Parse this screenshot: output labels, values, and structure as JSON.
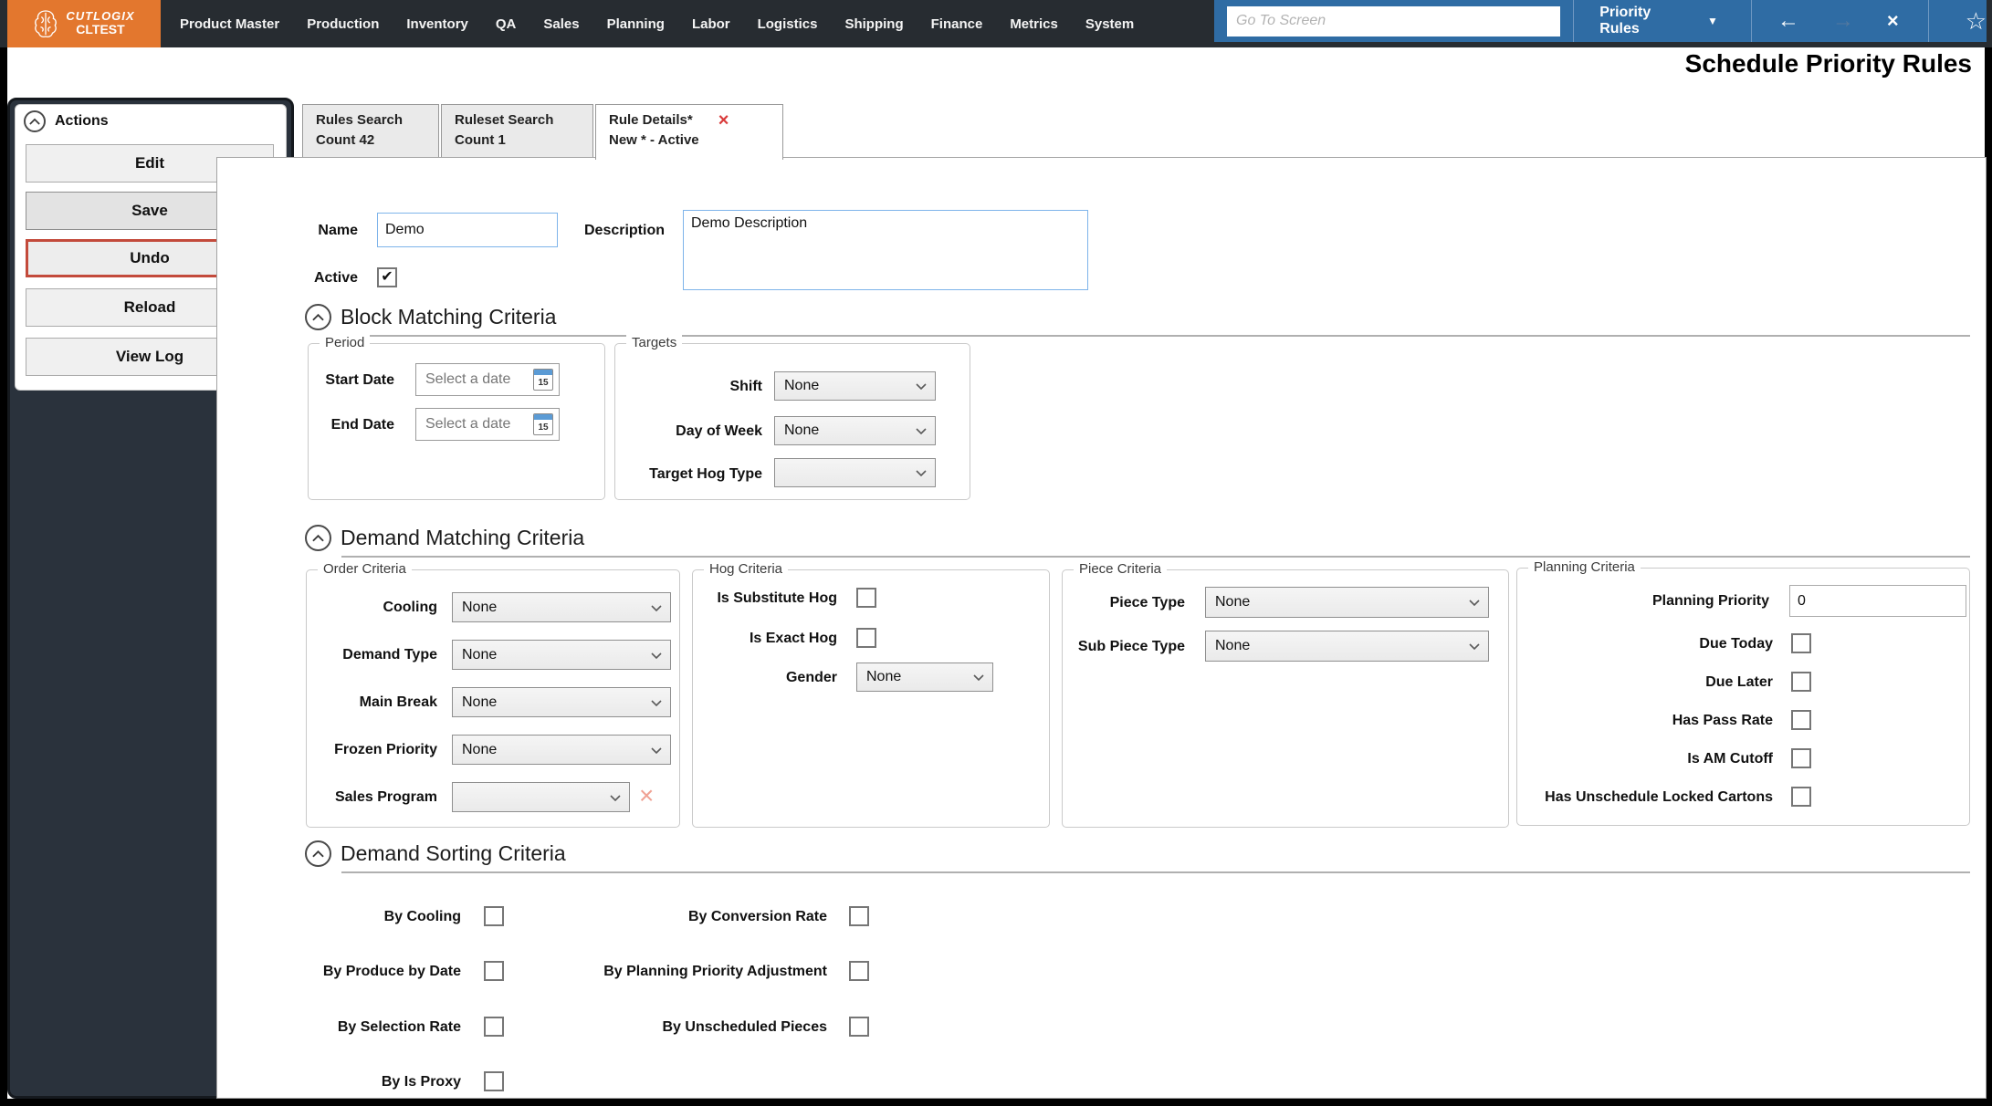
{
  "topbar": {
    "brand_line1": "CUTLOGIX",
    "brand_line2": "CLTEST",
    "menu": [
      "Product Master",
      "Production",
      "Inventory",
      "QA",
      "Sales",
      "Planning",
      "Labor",
      "Logistics",
      "Shipping",
      "Finance",
      "Metrics",
      "System"
    ],
    "goto_placeholder": "Go To Screen",
    "nav_selector": "Priority Rules"
  },
  "page_title": "Schedule Priority Rules",
  "tabs": {
    "rules_search": {
      "line1": "Rules Search",
      "line2": "Count 42"
    },
    "ruleset_search": {
      "line1": "Ruleset Search",
      "line2": "Count 1"
    },
    "rule_details": {
      "line1": "Rule Details*",
      "line2": "New * - Active"
    }
  },
  "actions": {
    "title": "Actions",
    "edit": "Edit",
    "save": "Save",
    "undo": "Undo",
    "reload": "Reload",
    "view_log": "View Log"
  },
  "form": {
    "name_label": "Name",
    "name_value": "Demo",
    "description_label": "Description",
    "description_value": "Demo Description",
    "active_label": "Active",
    "active_checked": true
  },
  "block_matching": {
    "title": "Block Matching Criteria",
    "period": {
      "legend": "Period",
      "start_label": "Start Date",
      "end_label": "End Date",
      "date_placeholder": "Select a date"
    },
    "targets": {
      "legend": "Targets",
      "shift_label": "Shift",
      "shift_value": "None",
      "dow_label": "Day of Week",
      "dow_value": "None",
      "hog_label": "Target Hog Type",
      "hog_value": ""
    }
  },
  "demand_matching": {
    "title": "Demand Matching Criteria",
    "order": {
      "legend": "Order Criteria",
      "rows": [
        {
          "label": "Cooling",
          "value": "None"
        },
        {
          "label": "Demand Type",
          "value": "None"
        },
        {
          "label": "Main Break",
          "value": "None"
        },
        {
          "label": "Frozen Priority",
          "value": "None"
        },
        {
          "label": "Sales Program",
          "value": ""
        }
      ]
    },
    "hog": {
      "legend": "Hog Criteria",
      "substitute_label": "Is Substitute Hog",
      "substitute_checked": false,
      "exact_label": "Is Exact Hog",
      "exact_checked": false,
      "gender_label": "Gender",
      "gender_value": "None"
    },
    "piece": {
      "legend": "Piece Criteria",
      "rows": [
        {
          "label": "Piece Type",
          "value": "None"
        },
        {
          "label": "Sub Piece Type",
          "value": "None"
        }
      ]
    },
    "planning": {
      "legend": "Planning Criteria",
      "priority_label": "Planning Priority",
      "priority_value": "0",
      "checks": [
        {
          "label": "Due Today",
          "checked": false
        },
        {
          "label": "Due Later",
          "checked": false
        },
        {
          "label": "Has Pass Rate",
          "checked": false
        },
        {
          "label": "Is AM Cutoff",
          "checked": false
        },
        {
          "label": "Has Unschedule Locked Cartons",
          "checked": false
        }
      ]
    }
  },
  "demand_sorting": {
    "title": "Demand Sorting Criteria",
    "col1": [
      {
        "label": "By Cooling",
        "checked": false
      },
      {
        "label": "By Produce by Date",
        "checked": false
      },
      {
        "label": "By Selection Rate",
        "checked": false
      },
      {
        "label": "By Is Proxy",
        "checked": false
      }
    ],
    "col2": [
      {
        "label": "By Conversion Rate",
        "checked": false
      },
      {
        "label": "By Planning Priority Adjustment",
        "checked": false
      },
      {
        "label": "By Unscheduled Pieces",
        "checked": false
      }
    ]
  },
  "icons": {
    "calendar_day": "15",
    "back_arrow": "←",
    "forward_arrow": "→",
    "close_x": "×",
    "favorite_star": "☆",
    "dropdown_caret": "▼",
    "tab_close_x": "×",
    "clear_x": "×",
    "checkmark": "✔"
  },
  "colors": {
    "brand_orange": "#E3772E",
    "topbar_dark": "#272C31",
    "toolbar_blue": "#2F6CA4",
    "undo_highlight": "#C34A3B",
    "tab_close_red": "#D93B3B",
    "focus_blue": "#7EB4EA",
    "sidebar_dark": "#2A323C",
    "clear_pink": "#F0A193"
  }
}
